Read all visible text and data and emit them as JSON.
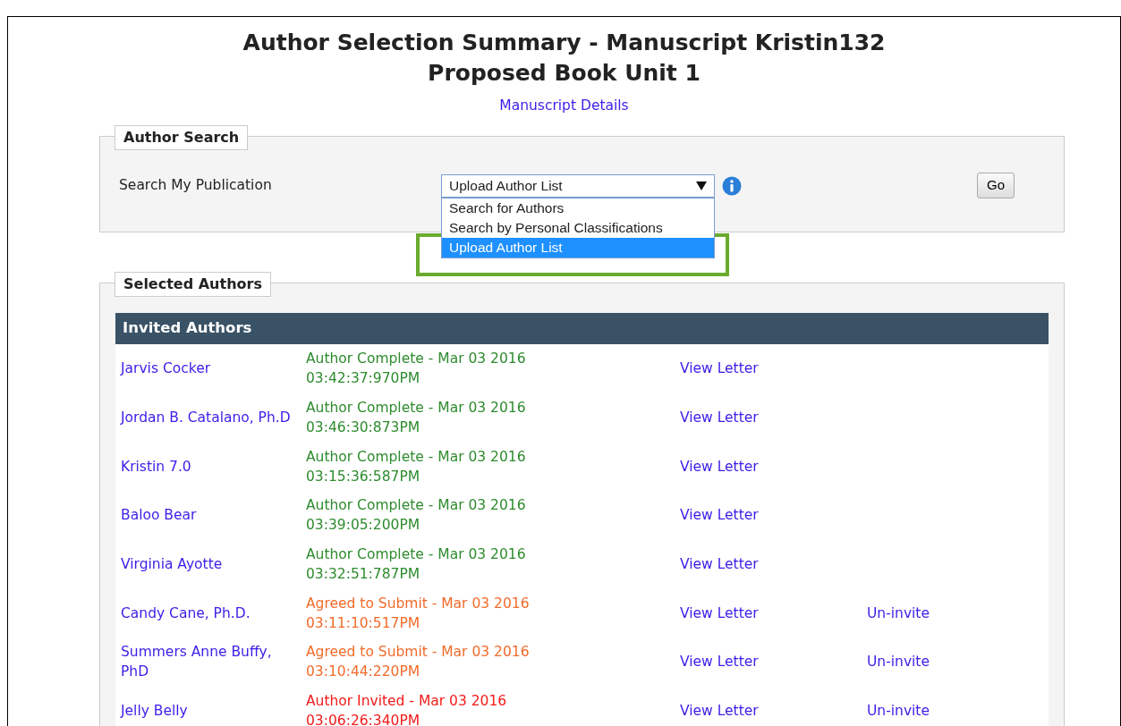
{
  "title_lines": [
    "Author Selection Summary - Manuscript Kristin132",
    "Proposed Book Unit 1"
  ],
  "details_link": "Manuscript Details",
  "author_search": {
    "legend": "Author Search",
    "label": "Search My Publication",
    "select_value": "Upload Author List",
    "expanded": true,
    "options": [
      {
        "label": "Search for Authors",
        "selected": false
      },
      {
        "label": "Search by Personal Classifications",
        "selected": false
      },
      {
        "label": "Upload Author List",
        "selected": true
      }
    ],
    "go_button": "Go"
  },
  "selected_authors": {
    "legend": "Selected Authors",
    "table_title": "Invited Authors",
    "rows": [
      {
        "name": "Jarvis Cocker",
        "status": "Author Complete - Mar 03 2016",
        "time": "03:42:37:970PM",
        "color": "#2e8b2e",
        "letter": "View Letter"
      },
      {
        "name": "Jordan B. Catalano, Ph.D",
        "status": "Author Complete - Mar 03 2016",
        "time": "03:46:30:873PM",
        "color": "#2e8b2e",
        "letter": "View Letter"
      },
      {
        "name": "Kristin 7.0",
        "status": "Author Complete - Mar 03 2016",
        "time": "03:15:36:587PM",
        "color": "#2e8b2e",
        "letter": "View Letter"
      },
      {
        "name": "Baloo Bear",
        "status": "Author Complete - Mar 03 2016",
        "time": "03:39:05:200PM",
        "color": "#2e8b2e",
        "letter": "View Letter"
      },
      {
        "name": "Virginia Ayotte",
        "status": "Author Complete - Mar 03 2016",
        "time": "03:32:51:787PM",
        "color": "#2e8b2e",
        "letter": "View Letter"
      },
      {
        "name": "Candy Cane, Ph.D.",
        "status": "Agreed to Submit - Mar 03 2016",
        "time": "03:11:10:517PM",
        "color": "#f26b2a",
        "letter": "View Letter",
        "uninvite": "Un-invite"
      },
      {
        "name": "Summers Anne Buffy, PhD",
        "status": "Agreed to Submit - Mar 03 2016",
        "time": "03:10:44:220PM",
        "color": "#f26b2a",
        "letter": "View Letter",
        "uninvite": "Un-invite"
      },
      {
        "name": "Jelly Belly",
        "status": "Author Invited - Mar 03 2016",
        "time": "03:06:26:340PM",
        "color": "#f21b1b",
        "letter": "View Letter",
        "uninvite": "Un-invite"
      }
    ]
  }
}
